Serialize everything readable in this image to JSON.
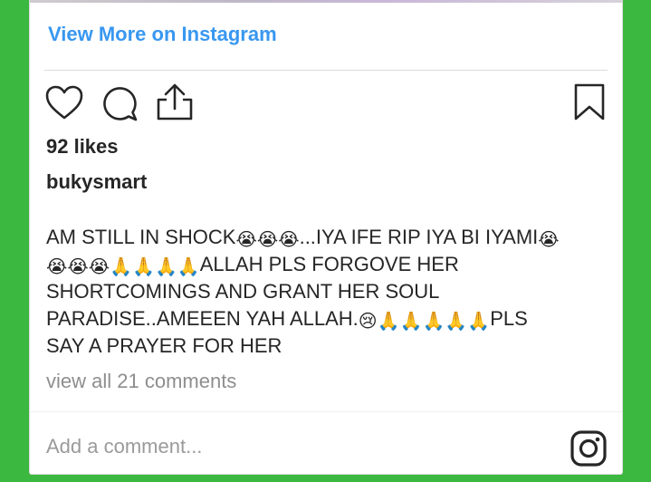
{
  "post": {
    "view_more_label": "View More on Instagram",
    "likes": "92 likes",
    "username": "bukysmart",
    "caption": {
      "line1_a": "AM STILL IN SHOCK",
      "line1_b": "...IYA IFE RIP IYA BI IYAMI",
      "line2": "ALLAH PLS FORGOVE HER",
      "line3": "SHORTCOMINGS AND GRANT HER SOUL",
      "line4_a": "PARADISE..AMEEEN YAH ALLAH.",
      "line4_b": "PLS",
      "line5": "SAY A PRAYER FOR HER",
      "emoji_cry": "😭",
      "emoji_sad": "😢",
      "emoji_pray": "🙏"
    },
    "comments_link": "view all 21 comments",
    "comment_placeholder": "Add a comment..."
  },
  "icons": [
    "heart-icon",
    "comment-icon",
    "share-icon",
    "bookmark-icon",
    "instagram-logo-icon"
  ],
  "colors": {
    "link": "#3897f0",
    "text": "#262626",
    "muted": "#8e8e8e",
    "frame": "#3bb83f"
  }
}
